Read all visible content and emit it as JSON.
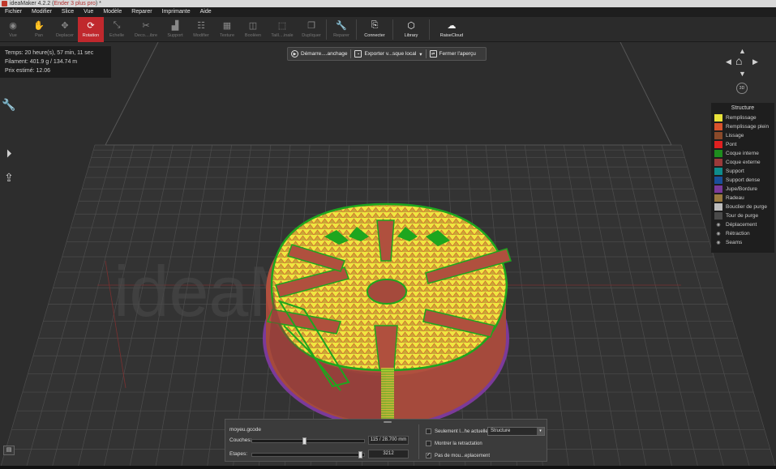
{
  "window": {
    "title_prefix": "ideaMaker 4.2.2 (",
    "title_project": "Ender 3 plus pro",
    "title_suffix": ") *"
  },
  "menu": [
    "Fichier",
    "Modifier",
    "Slice",
    "Vue",
    "Modèle",
    "Reparer",
    "Imprimante",
    "Aide"
  ],
  "toolbar": {
    "vue": "Vue",
    "pan": "Pan",
    "deplacer": "Deplacer",
    "rotation": "Rotation",
    "echelle": "Echelle",
    "decoupe": "Deco....ibre",
    "support": "Support",
    "modifier": "Modifier",
    "texture": "Texture",
    "booleen": "Booléen",
    "taille": "Taill....inale",
    "dupliquer": "Dupliquer",
    "reparer": "Reparer",
    "connecter": "Connecter",
    "library": "Library",
    "raisecloud": "RaiseCloud"
  },
  "info": {
    "temps": "Temps: 20 heure(s), 57 min, 11 sec",
    "filament": "Filament: 401.9 g / 134.74 m",
    "prix": "Prix estimé: 12.06"
  },
  "preview": {
    "start": "Démarre....anchage",
    "export": "Exporter v...sque local",
    "close": "Fermer l'aperçu"
  },
  "nav": {
    "view3d": "3D"
  },
  "watermark": "ideaMaker",
  "legend": {
    "title": "Structure",
    "items": [
      {
        "label": "Remplissage",
        "color": "#e8e23a"
      },
      {
        "label": "Remplissage plein",
        "color": "#d9532c"
      },
      {
        "label": "Lissage",
        "color": "#8a4a2a"
      },
      {
        "label": "Pont",
        "color": "#e02020"
      },
      {
        "label": "Coque interne",
        "color": "#1e8c1e"
      },
      {
        "label": "Coque externe",
        "color": "#9a3a3a"
      },
      {
        "label": "Support",
        "color": "#0e8c8c"
      },
      {
        "label": "Support dense",
        "color": "#1a4f9a"
      },
      {
        "label": "Jupe/Bordure",
        "color": "#7b3a9a"
      },
      {
        "label": "Radeau",
        "color": "#9a7a40"
      },
      {
        "label": "Bouclier de purge",
        "color": "#bdbdbd"
      },
      {
        "label": "Tour de purge",
        "color": "#4a4a4a"
      }
    ],
    "toggles": [
      "Déplacement",
      "Rétraction",
      "Seams"
    ]
  },
  "bottom": {
    "filename": "moyeu.gcode",
    "couches_label": "Couches:",
    "couches_value": "115 / 28.700 mm",
    "couches_position": 0.46,
    "etapes_label": "Etapes:",
    "etapes_value": "3212",
    "etapes_position": 0.98,
    "chk_layer": "Seulement l...he actuelle",
    "chk_retract": "Montrer la retractation",
    "chk_travel": "Pas de mou...eplacement",
    "structure_select": "Structure"
  }
}
